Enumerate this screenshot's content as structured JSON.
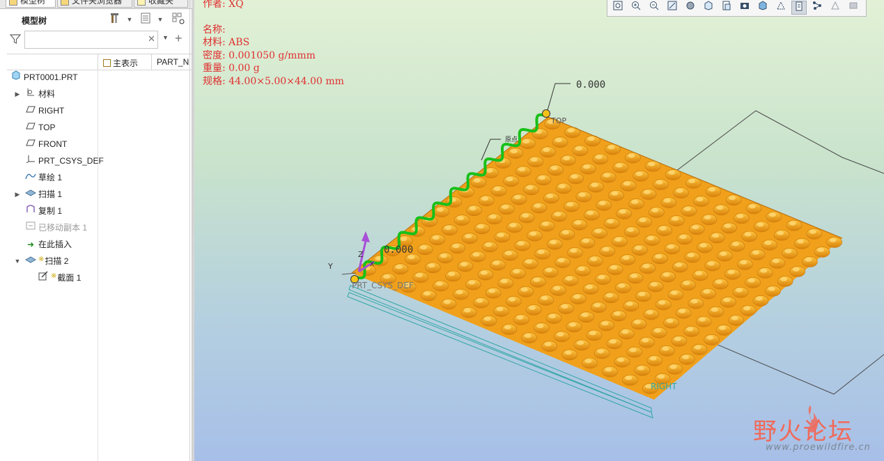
{
  "panel_tabs": [
    {
      "label": "模型树"
    },
    {
      "label": "文件夹浏览器"
    },
    {
      "label": "收藏夹"
    }
  ],
  "model_tree": {
    "title": "模型树",
    "filter_placeholder": "",
    "columns": {
      "main": "主表示",
      "part": "PART_N"
    },
    "items": [
      {
        "label": "PRT0001.PRT",
        "icon": "part-icon"
      },
      {
        "label": "材料",
        "icon": "material-icon"
      },
      {
        "label": "RIGHT",
        "icon": "datum-plane-icon"
      },
      {
        "label": "TOP",
        "icon": "datum-plane-icon"
      },
      {
        "label": "FRONT",
        "icon": "datum-plane-icon"
      },
      {
        "label": "PRT_CSYS_DEF",
        "icon": "csys-icon"
      },
      {
        "label": "草绘 1",
        "icon": "sketch-icon"
      },
      {
        "label": "扫描 1",
        "icon": "sweep-icon"
      },
      {
        "label": "复制 1",
        "icon": "copy-icon"
      },
      {
        "label": "已移动副本 1",
        "icon": "moved-copy-icon"
      },
      {
        "label": "在此插入",
        "icon": "insert-here-icon"
      },
      {
        "label": "扫描 2",
        "icon": "sweep-icon",
        "mark": "※"
      },
      {
        "label": "截面 1",
        "icon": "section-icon",
        "mark": "※"
      }
    ]
  },
  "part_info": {
    "author": "作者: XQ",
    "name": "名称:",
    "material": "材料: ABS",
    "density": "密度: 0.001050  g/mmm",
    "weight": "重量: 0.00 g",
    "spec": "规格: 44.00×5.00×44.00 mm"
  },
  "view_toolbar": [
    "zoom-fit-icon",
    "zoom-in-icon",
    "zoom-out-icon",
    "repaint-icon",
    "display-style-icon",
    "saved-views-icon",
    "view-manager-icon",
    "perspective-icon",
    "section-icon",
    "datum-display-icon",
    "annotation-display-icon",
    "spin-center-icon",
    "axis-display-icon",
    "csys-display-icon"
  ],
  "viewport": {
    "dim_top": "0.000",
    "dim_left": "0.000",
    "label_top": "TOP",
    "label_right": "RIGHT",
    "label_csys": "PRT_CSYS_DEF",
    "label_y": "Y",
    "label_z": "Z",
    "label_x": "X",
    "label_trajectory": "原点"
  },
  "colors": {
    "model_orange": "#f5a61c",
    "sweep_green": "#19c019",
    "info_red": "#e03030"
  },
  "watermark": {
    "title": "野火论坛",
    "url": "www.proewildfire.cn"
  }
}
